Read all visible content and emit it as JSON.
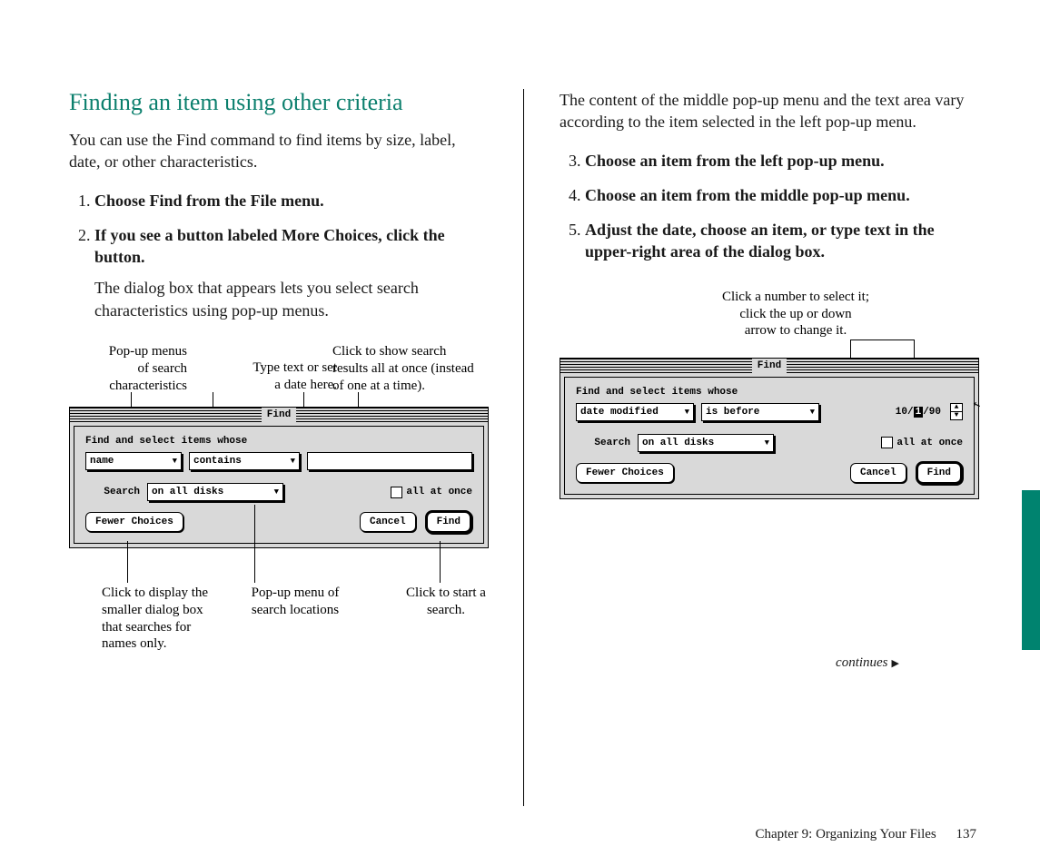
{
  "left": {
    "heading": "Finding an item using other criteria",
    "intro": "You can use the Find command to find items by size, label, date, or other characteristics.",
    "step1": "Choose Find from the File menu.",
    "step2_title": "If you see a button labeled More Choices, click the button.",
    "step2_body": "The dialog box that appears lets you select search characteristics using pop-up menus.",
    "callouts": {
      "a1": "Pop-up menus",
      "a2": "of search",
      "a3": "characteristics",
      "b1": "Type text or set",
      "b2": "a date here.",
      "c1": "Click to show search",
      "c2": "results all at once (instead",
      "c3": "of one at a time).",
      "d1": "Click to display the",
      "d2": "smaller dialog box",
      "d3": "that searches  for",
      "d4": "names only.",
      "e1": "Pop-up menu of",
      "e2": "search locations",
      "f1": "Click to start a",
      "f2": "search."
    },
    "dialog": {
      "title": "Find",
      "prompt": "Find and select items whose",
      "attr_popup": "name",
      "op_popup": "contains",
      "search_label": "Search",
      "loc_popup": "on all disks",
      "all_at_once": "all at once",
      "fewer": "Fewer Choices",
      "cancel": "Cancel",
      "find": "Find"
    }
  },
  "right": {
    "intro": "The content of the middle pop-up menu and the text area vary according to the item selected in the left pop-up menu.",
    "step3": "Choose an item from the left pop-up menu.",
    "step4": "Choose an item from the middle pop-up menu.",
    "step5": "Adjust the date, choose an item, or type text in the upper-right area of the dialog box.",
    "callouts": {
      "g1": "Click a number to select it;",
      "g2": "click the up or down",
      "g3": "arrow to change it."
    },
    "dialog": {
      "title": "Find",
      "prompt": "Find and select items whose",
      "attr_popup": "date modified",
      "op_popup": "is before",
      "date_m": "10",
      "date_d": "1",
      "date_y": "90",
      "search_label": "Search",
      "loc_popup": "on all disks",
      "all_at_once": "all at once",
      "fewer": "Fewer Choices",
      "cancel": "Cancel",
      "find": "Find"
    },
    "continues": "continues"
  },
  "footer": {
    "chapter": "Chapter 9: Organizing Your Files",
    "page": "137"
  }
}
